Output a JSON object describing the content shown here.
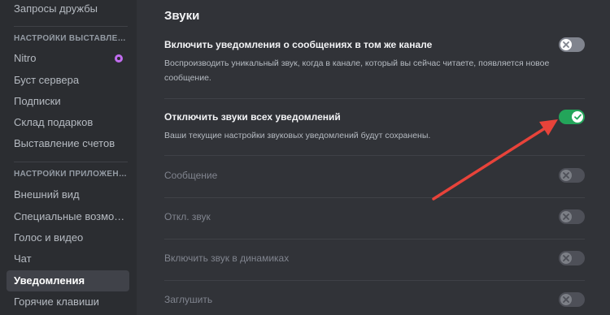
{
  "sidebar": {
    "top_item": "Запросы дружбы",
    "section1_header": "НАСТРОЙКИ ВЫСТАВЛЕН...",
    "items1": [
      "Nitro",
      "Буст сервера",
      "Подписки",
      "Склад подарков",
      "Выставление счетов"
    ],
    "section2_header": "НАСТРОЙКИ ПРИЛОЖЕНИЯ",
    "items2": [
      "Внешний вид",
      "Специальные возмож...",
      "Голос и видео",
      "Чат",
      "Уведомления",
      "Горячие клавиши"
    ],
    "active_item": "Уведомления"
  },
  "main": {
    "title": "Звуки",
    "rows": [
      {
        "title": "Включить уведомления о сообщениях в том же канале",
        "description": "Воспроизводить уникальный звук, когда в канале, который вы сейчас читаете, появляется новое сообщение.",
        "toggle": "off"
      },
      {
        "title": "Отключить звуки всех уведомлений",
        "description": "Ваши текущие настройки звуковых уведомлений будут сохранены.",
        "toggle": "on"
      },
      {
        "title": "Сообщение",
        "toggle": "disabled"
      },
      {
        "title": "Откл. звук",
        "toggle": "disabled"
      },
      {
        "title": "Включить звук в динамиках",
        "toggle": "disabled"
      },
      {
        "title": "Заглушить",
        "toggle": "disabled"
      }
    ]
  },
  "colors": {
    "background": "#313338",
    "sidebar": "#2b2d31",
    "toggle_on": "#23a55a",
    "toggle_off": "#80848e",
    "arrow": "#e8433a",
    "nitro": "#c26df0"
  },
  "icons": [
    "x-icon",
    "check-icon",
    "arrow-annotation",
    "nitro-icon"
  ]
}
